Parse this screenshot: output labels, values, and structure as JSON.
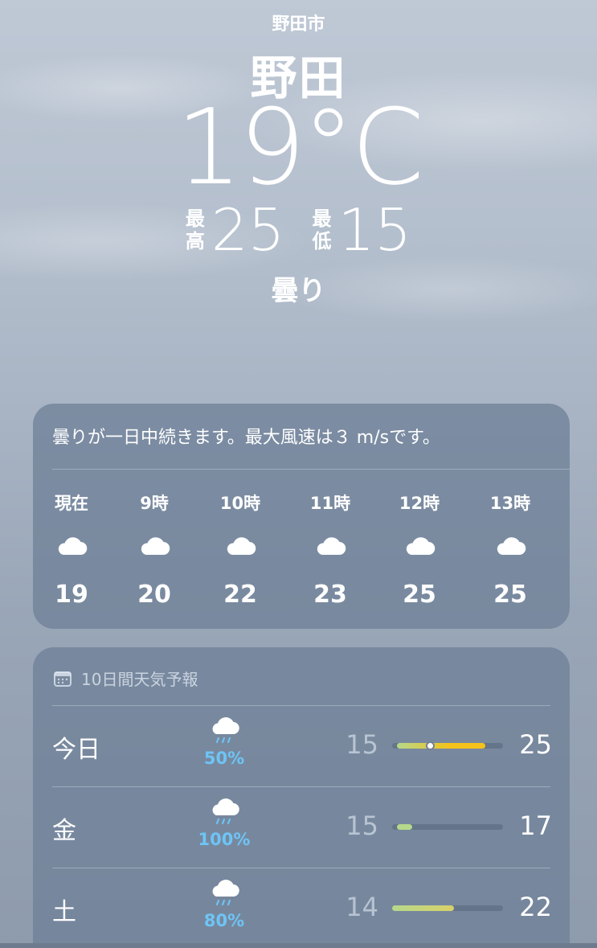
{
  "location": {
    "city_small": "野田市",
    "city": "野田"
  },
  "current": {
    "temperature": "19°C",
    "high_label": "最高",
    "high": "25",
    "low_label": "最低",
    "low": "15",
    "condition": "曇り"
  },
  "hourly": {
    "summary": "曇りが一日中続きます。最大風速は３ m/sです。",
    "items": [
      {
        "time": "現在",
        "icon": "cloud-icon",
        "temp": "19"
      },
      {
        "time": "9時",
        "icon": "cloud-icon",
        "temp": "20"
      },
      {
        "time": "10時",
        "icon": "cloud-icon",
        "temp": "22"
      },
      {
        "time": "11時",
        "icon": "cloud-icon",
        "temp": "23"
      },
      {
        "time": "12時",
        "icon": "cloud-icon",
        "temp": "25"
      },
      {
        "time": "13時",
        "icon": "cloud-icon",
        "temp": "25"
      }
    ]
  },
  "daily": {
    "header": "10日間天気予報",
    "header_icon": "calendar-icon",
    "items": [
      {
        "day": "今日",
        "icon": "rain-cloud-icon",
        "precip": "50%",
        "low": "15",
        "high": "25",
        "bar_start": 0.04,
        "bar_end": 0.84,
        "current_marker": 0.34
      },
      {
        "day": "金",
        "icon": "rain-cloud-icon",
        "precip": "100%",
        "low": "15",
        "high": "17",
        "bar_start": 0.04,
        "bar_end": 0.18
      },
      {
        "day": "土",
        "icon": "rain-cloud-icon",
        "precip": "80%",
        "low": "14",
        "high": "22",
        "bar_start": 0.0,
        "bar_end": 0.56
      }
    ]
  },
  "colors": {
    "rain_percent": "#6ec4f5",
    "bar_cool": "#b6d88a",
    "bar_warm": "#f4c21a",
    "bar_mild": "#d9d06a"
  }
}
